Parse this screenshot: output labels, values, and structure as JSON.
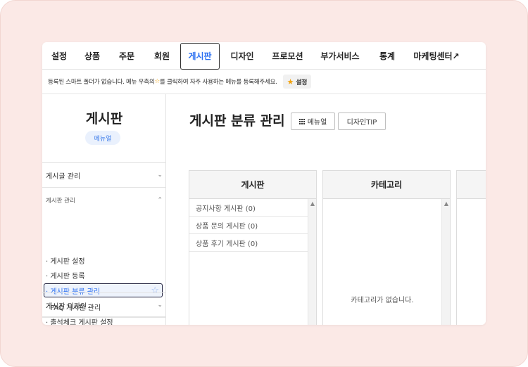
{
  "nav": {
    "items": [
      "설정",
      "상품",
      "주문",
      "회원",
      "게시판",
      "디자인",
      "프로모션",
      "부가서비스",
      "통계",
      "마케팅센터↗"
    ],
    "active": "게시판"
  },
  "notice": {
    "text_before": "등록된 스마트 폴더가 없습니다. 메뉴 우측의 ",
    "star": "☆",
    "text_after": "를 클릭하여 자주 사용하는 메뉴를 등록해주세요.",
    "button_star": "★",
    "button_label": "설정"
  },
  "sidebar": {
    "title": "게시판",
    "badge": "메뉴얼",
    "sections": [
      {
        "label": "게시글 관리",
        "chevron": "⌄"
      },
      {
        "label": "게시판 관리",
        "chevron": "⌃"
      },
      {
        "label": "게시판 디자인",
        "chevron": "⌄"
      }
    ],
    "links": [
      "· 게시판 설정",
      "· 게시판 등록",
      "· 게시판 분류 관리",
      "· FAQ 게시판 관리",
      "· 출석체크 게시판 설정"
    ],
    "fav_star": "☆"
  },
  "main": {
    "title": "게시판 분류 관리",
    "manual_button": "메뉴얼",
    "design_tip_button": "디자인TIP"
  },
  "panels": {
    "board": {
      "header": "게시판",
      "items": [
        "공지사항 게시판 (0)",
        "상품 문의 게시판 (0)",
        "상품 후기 게시판 (0)"
      ]
    },
    "category": {
      "header": "카테고리",
      "empty": "카테고리가 없습니다."
    },
    "scroll_up": "▲"
  },
  "colors": {
    "accent": "#2a6ff1",
    "background": "#fbe9e6"
  }
}
